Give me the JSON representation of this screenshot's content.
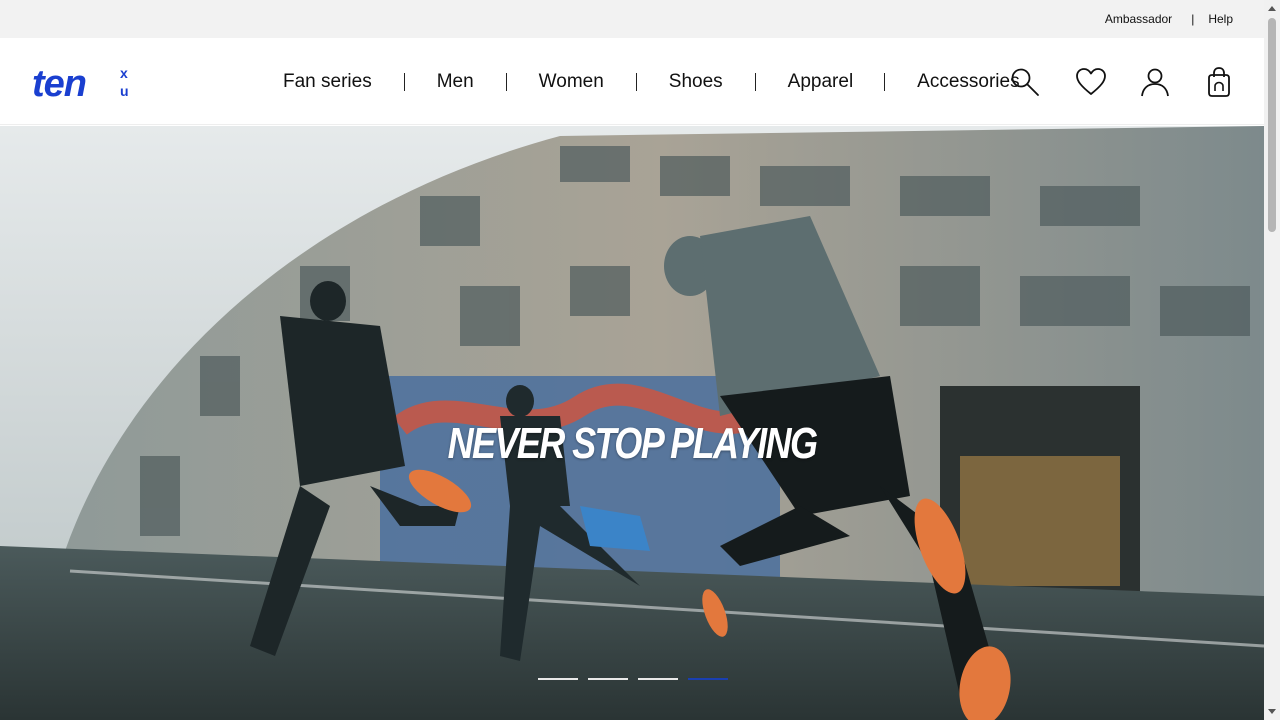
{
  "utility": {
    "ambassador": "Ambassador",
    "separator": "|",
    "help": "Help"
  },
  "brand": {
    "name": "ten",
    "suffix_top": "x",
    "suffix_bottom": "u",
    "color": "#1a3fd0"
  },
  "nav": {
    "items": [
      {
        "label": "Fan series"
      },
      {
        "label": "Men"
      },
      {
        "label": "Women"
      },
      {
        "label": "Shoes"
      },
      {
        "label": "Apparel"
      },
      {
        "label": "Accessories"
      }
    ]
  },
  "header_icons": [
    "search-icon",
    "heart-icon",
    "user-icon",
    "bag-icon"
  ],
  "hero": {
    "title": "NEVER STOP PLAYING",
    "slides_total": 4,
    "active_slide": 4,
    "accent": "#1a3fb0"
  }
}
